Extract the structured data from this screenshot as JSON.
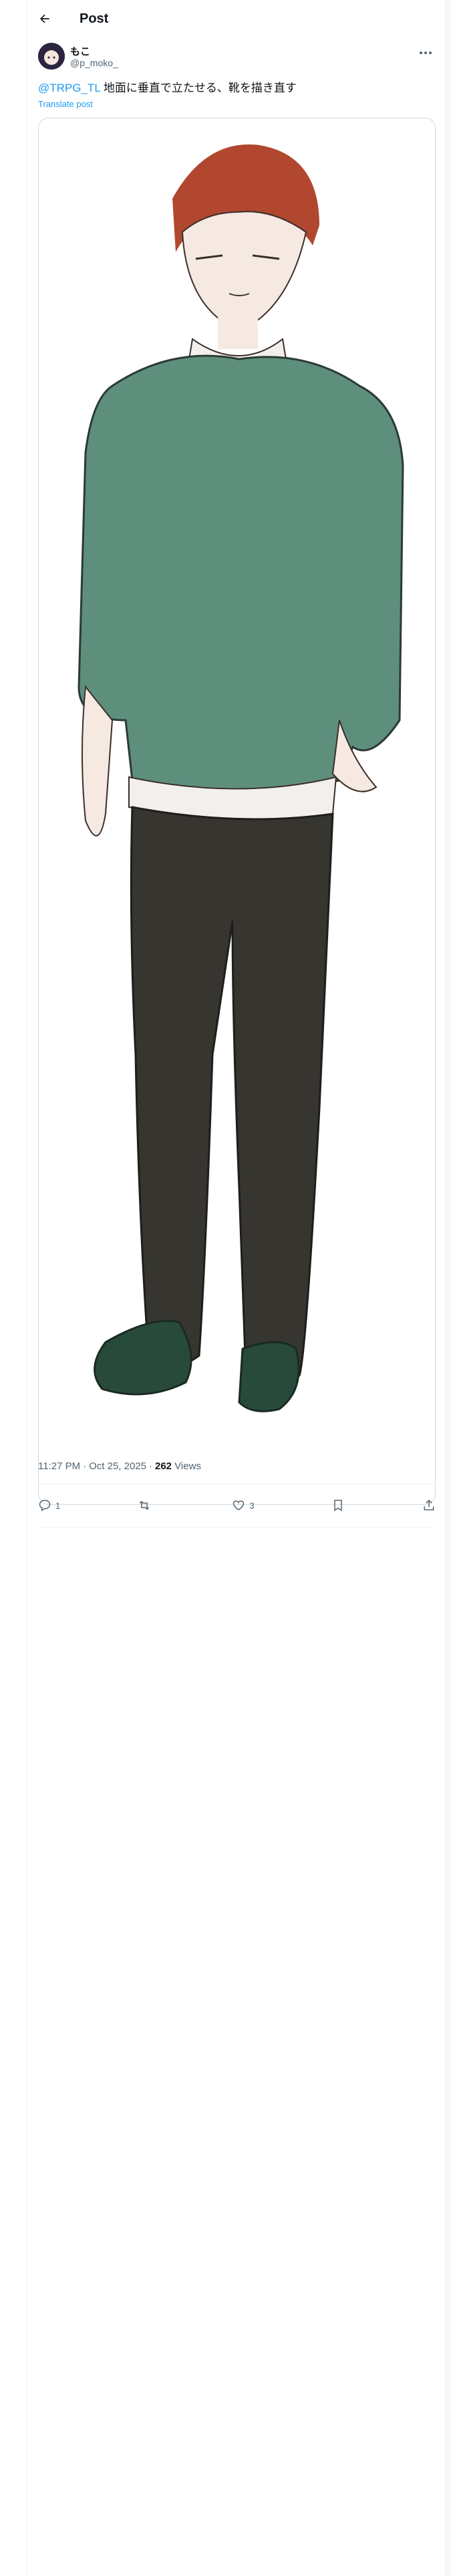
{
  "header": {
    "title": "Post",
    "back_icon": "arrow-left-icon"
  },
  "author": {
    "name": "もこ",
    "handle": "@p_moko_",
    "more_icon": "more-horizontal-icon"
  },
  "post": {
    "mention": "@TRPG_TL",
    "text": " 地面に垂直で立たせる、靴を描き直す",
    "translate_label": "Translate post",
    "media_icon": "illustration-image"
  },
  "meta": {
    "time": "11:27 PM",
    "date": "Oct 25, 2025",
    "views_count": "262",
    "views_label": "Views",
    "separator": "·"
  },
  "actions": {
    "reply_count": "1",
    "repost_count": "",
    "like_count": "3",
    "icons": [
      "reply-icon",
      "repost-icon",
      "like-icon",
      "bookmark-icon",
      "share-icon"
    ]
  },
  "colors": {
    "accent": "#1d9bf0",
    "secondary_text": "#536471",
    "border": "#eff3f4"
  }
}
